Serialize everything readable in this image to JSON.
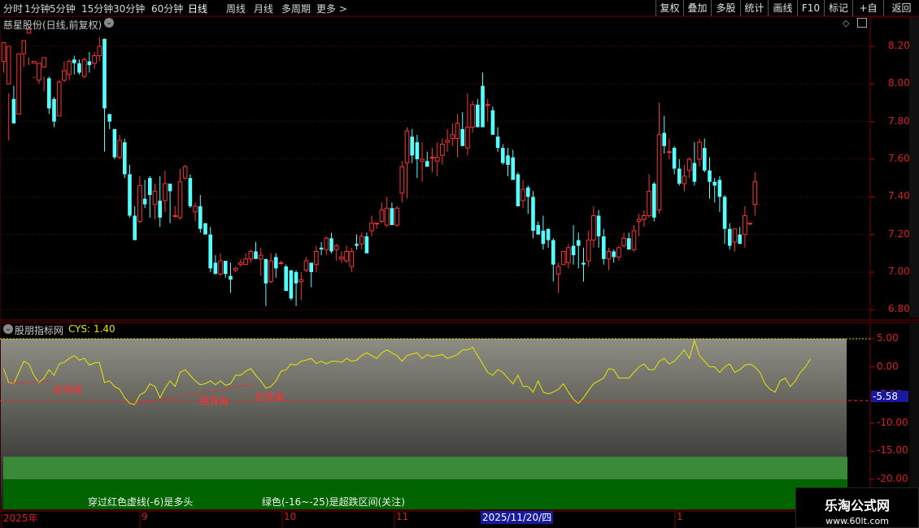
{
  "timeframes": [
    "分时",
    "1分钟",
    "5分钟",
    "15分钟",
    "30分钟",
    "60分钟",
    "日线",
    "周线",
    "月线",
    "多周期",
    "更多 >"
  ],
  "active_timeframe": "日线",
  "toolbar": [
    "复权",
    "叠加",
    "多股",
    "统计",
    "画线",
    "F10",
    "标记",
    "+自选",
    "返回"
  ],
  "main_panel": {
    "title": "慈星股份(日线,前复权)"
  },
  "price_axis": [
    "8.20",
    "8.00",
    "7.80",
    "7.60",
    "7.40",
    "7.20",
    "7.00",
    "6.80"
  ],
  "indicator_panel": {
    "title": "股朋指标网",
    "cys_label": "CYS: 1.40",
    "current_value": "-5.58"
  },
  "indicator_axis": [
    "5.00",
    "0.00",
    "-5.00",
    "-10.00",
    "-15.00",
    "-20.00"
  ],
  "divergence_label": "底背离",
  "notes": [
    "穿过红色虚线(-6)是多头",
    "绿色(-16~-25)是超跌区间(关注)"
  ],
  "date_axis": {
    "labels": [
      "2025年",
      "9",
      "10",
      "11",
      "1"
    ],
    "highlight": "2025/11/20/四"
  },
  "watermark": {
    "name": "乐淘公式网",
    "url": "www.60lt.com"
  },
  "colors": {
    "up": "#ff3232",
    "down": "#54ffff",
    "indicator_line": "#e6e600",
    "red_dash": "#ff2020",
    "oversold_light": "#3a8a3a",
    "oversold_dark": "#006400"
  },
  "chart_data": {
    "type": "candlestick",
    "price_range": [
      6.76,
      8.3
    ],
    "candles": [
      [
        8.12,
        8.22,
        8.14,
        8.06
      ],
      [
        8.0,
        8.2,
        7.95,
        7.7
      ],
      [
        7.92,
        7.79,
        7.99,
        7.79
      ],
      [
        7.84,
        8.16,
        8.16,
        7.84
      ],
      [
        8.16,
        8.23,
        8.22,
        8.09
      ],
      [
        8.27,
        8.29,
        8.14,
        8.1
      ],
      [
        8.11,
        8.12,
        8.04,
        8.03
      ],
      [
        8.02,
        8.11,
        8.08,
        8.0
      ],
      [
        8.09,
        8.14,
        8.04,
        7.96
      ],
      [
        8.03,
        7.87,
        8.04,
        7.84
      ],
      [
        7.92,
        7.8,
        7.93,
        7.77
      ],
      [
        7.83,
        8.01,
        8.02,
        7.83
      ],
      [
        8.02,
        8.07,
        8.12,
        8.01
      ],
      [
        8.05,
        8.12,
        8.13,
        8.02
      ],
      [
        8.13,
        8.11,
        8.15,
        8.05
      ],
      [
        8.11,
        8.06,
        8.13,
        8.05
      ],
      [
        8.04,
        8.13,
        8.14,
        8.03
      ],
      [
        8.12,
        8.1,
        8.17,
        8.06
      ],
      [
        8.11,
        8.15,
        8.17,
        8.08
      ],
      [
        8.15,
        8.2,
        8.25,
        8.12
      ],
      [
        8.24,
        7.87,
        8.24,
        7.64
      ],
      [
        7.84,
        7.8,
        7.84,
        7.76
      ],
      [
        7.76,
        7.61,
        7.76,
        7.6
      ],
      [
        7.61,
        7.7,
        7.73,
        7.6
      ],
      [
        7.69,
        7.52,
        7.71,
        7.5
      ],
      [
        7.52,
        7.3,
        7.57,
        7.29
      ],
      [
        7.3,
        7.17,
        7.35,
        7.17
      ],
      [
        7.27,
        7.46,
        7.51,
        7.26
      ],
      [
        7.39,
        7.36,
        7.49,
        7.34
      ],
      [
        7.5,
        7.41,
        7.51,
        7.29
      ],
      [
        7.36,
        7.43,
        7.47,
        7.28
      ],
      [
        7.38,
        7.29,
        7.51,
        7.24
      ],
      [
        7.38,
        7.47,
        7.54,
        7.32
      ],
      [
        7.47,
        7.43,
        7.47,
        7.26
      ],
      [
        7.3,
        7.3,
        7.35,
        7.29
      ],
      [
        7.29,
        7.48,
        7.55,
        7.28
      ],
      [
        7.5,
        7.56,
        7.57,
        7.49
      ],
      [
        7.5,
        7.35,
        7.52,
        7.34
      ],
      [
        7.32,
        7.35,
        7.37,
        7.27
      ],
      [
        7.35,
        7.23,
        7.41,
        7.21
      ],
      [
        7.26,
        7.2,
        7.26,
        7.2
      ],
      [
        7.2,
        7.02,
        7.24,
        7.0
      ],
      [
        7.05,
        6.99,
        7.09,
        6.99
      ],
      [
        6.99,
        7.06,
        7.1,
        6.98
      ],
      [
        7.06,
        6.99,
        7.06,
        6.97
      ],
      [
        6.98,
        6.96,
        7.05,
        6.89
      ],
      [
        7.01,
        7.02,
        7.03,
        7.0
      ],
      [
        7.04,
        7.05,
        7.07,
        7.03
      ],
      [
        7.04,
        7.07,
        7.1,
        7.04
      ],
      [
        7.07,
        7.11,
        7.12,
        7.05
      ],
      [
        7.11,
        7.07,
        7.16,
        7.07
      ],
      [
        7.07,
        7.09,
        7.13,
        6.98
      ],
      [
        7.07,
        6.94,
        7.07,
        6.82
      ],
      [
        6.95,
        7.06,
        7.1,
        6.94
      ],
      [
        7.08,
        7.02,
        7.1,
        6.97
      ],
      [
        7.05,
        7.05,
        7.06,
        7.04
      ],
      [
        7.03,
        6.9,
        7.04,
        6.9
      ],
      [
        7.01,
        6.86,
        7.0,
        6.85
      ],
      [
        7.0,
        6.94,
        7.01,
        6.82
      ],
      [
        6.95,
        6.96,
        7.0,
        6.85
      ],
      [
        7.01,
        7.06,
        7.08,
        7.0
      ],
      [
        7.05,
        7.0,
        7.05,
        6.92
      ],
      [
        7.04,
        7.11,
        7.14,
        7.0
      ],
      [
        7.13,
        7.12,
        7.16,
        7.09
      ],
      [
        7.12,
        7.18,
        7.19,
        7.09
      ],
      [
        7.18,
        7.11,
        7.21,
        7.1
      ],
      [
        7.12,
        7.14,
        7.15,
        7.06
      ],
      [
        7.07,
        7.08,
        7.11,
        7.05
      ],
      [
        7.06,
        7.11,
        7.14,
        7.05
      ],
      [
        7.03,
        7.11,
        7.13,
        7.0
      ],
      [
        7.15,
        7.14,
        7.2,
        7.12
      ],
      [
        7.15,
        7.19,
        7.21,
        7.12
      ],
      [
        7.19,
        7.1,
        7.21,
        7.1
      ],
      [
        7.22,
        7.26,
        7.3,
        7.19
      ],
      [
        7.26,
        7.26,
        7.26,
        7.23
      ],
      [
        7.27,
        7.33,
        7.37,
        7.26
      ],
      [
        7.25,
        7.34,
        7.4,
        7.24
      ],
      [
        7.34,
        7.25,
        7.37,
        7.26
      ],
      [
        7.25,
        7.34,
        7.35,
        7.24
      ],
      [
        7.42,
        7.56,
        7.59,
        7.37
      ],
      [
        7.58,
        7.75,
        7.77,
        7.39
      ],
      [
        7.72,
        7.62,
        7.76,
        7.58
      ],
      [
        7.69,
        7.6,
        7.73,
        7.5
      ],
      [
        7.59,
        7.6,
        7.69,
        7.48
      ],
      [
        7.59,
        7.56,
        7.64,
        7.56
      ],
      [
        7.61,
        7.61,
        7.66,
        7.53
      ],
      [
        7.59,
        7.61,
        7.69,
        7.51
      ],
      [
        7.62,
        7.68,
        7.71,
        7.57
      ],
      [
        7.69,
        7.7,
        7.76,
        7.64
      ],
      [
        7.71,
        7.73,
        7.79,
        7.67
      ],
      [
        7.71,
        7.79,
        7.84,
        7.61
      ],
      [
        7.76,
        7.67,
        7.85,
        7.67
      ],
      [
        7.66,
        7.77,
        7.95,
        7.62
      ],
      [
        7.77,
        7.89,
        7.91,
        7.74
      ],
      [
        7.89,
        7.77,
        7.92,
        7.77
      ],
      [
        7.99,
        7.77,
        8.06,
        7.79
      ],
      [
        7.89,
        7.89,
        7.92,
        7.8
      ],
      [
        7.86,
        7.73,
        7.88,
        7.73
      ],
      [
        7.72,
        7.66,
        7.77,
        7.64
      ],
      [
        7.66,
        7.58,
        7.68,
        7.57
      ],
      [
        7.62,
        7.57,
        7.66,
        7.51
      ],
      [
        7.61,
        7.49,
        7.65,
        7.5
      ],
      [
        7.52,
        7.35,
        7.53,
        7.35
      ],
      [
        7.38,
        7.44,
        7.49,
        7.34
      ],
      [
        7.45,
        7.4,
        7.46,
        7.31
      ],
      [
        7.4,
        7.22,
        7.43,
        7.18
      ],
      [
        7.25,
        7.2,
        7.27,
        7.2
      ],
      [
        7.22,
        7.15,
        7.3,
        7.12
      ],
      [
        7.23,
        7.17,
        7.23,
        7.13
      ],
      [
        7.17,
        7.04,
        7.18,
        6.95
      ],
      [
        6.99,
        7.03,
        7.05,
        6.89
      ],
      [
        7.04,
        7.11,
        7.11,
        7.04
      ],
      [
        7.05,
        7.13,
        7.15,
        7.02
      ],
      [
        7.14,
        7.09,
        7.25,
        7.04
      ],
      [
        7.17,
        7.14,
        7.21,
        7.02
      ],
      [
        7.05,
        7.04,
        7.13,
        6.95
      ],
      [
        7.06,
        7.17,
        7.22,
        7.03
      ],
      [
        7.17,
        7.3,
        7.35,
        7.13
      ],
      [
        7.3,
        7.19,
        7.33,
        7.13
      ],
      [
        7.19,
        7.07,
        7.23,
        7.04
      ],
      [
        7.07,
        7.11,
        7.13,
        7.01
      ],
      [
        7.11,
        7.08,
        7.12,
        7.05
      ],
      [
        7.08,
        7.13,
        7.14,
        7.06
      ],
      [
        7.14,
        7.18,
        7.21,
        7.13
      ],
      [
        7.18,
        7.12,
        7.21,
        7.12
      ],
      [
        7.12,
        7.22,
        7.25,
        7.11
      ],
      [
        7.27,
        7.28,
        7.31,
        7.19
      ],
      [
        7.28,
        7.3,
        7.33,
        7.24
      ],
      [
        7.3,
        7.43,
        7.52,
        7.29
      ],
      [
        7.47,
        7.29,
        7.48,
        7.27
      ],
      [
        7.33,
        7.73,
        7.9,
        7.31
      ],
      [
        7.74,
        7.67,
        7.83,
        7.63
      ],
      [
        7.64,
        7.64,
        7.71,
        7.6
      ],
      [
        7.66,
        7.55,
        7.67,
        7.52
      ],
      [
        7.55,
        7.47,
        7.6,
        7.46
      ],
      [
        7.47,
        7.51,
        7.57,
        7.43
      ],
      [
        7.54,
        7.6,
        7.61,
        7.5
      ],
      [
        7.58,
        7.48,
        7.69,
        7.46
      ],
      [
        7.6,
        7.69,
        7.71,
        7.56
      ],
      [
        7.66,
        7.54,
        7.71,
        7.53
      ],
      [
        7.54,
        7.48,
        7.61,
        7.39
      ],
      [
        7.48,
        7.46,
        7.5,
        7.37
      ],
      [
        7.49,
        7.4,
        7.51,
        7.32
      ],
      [
        7.4,
        7.23,
        7.41,
        7.15
      ],
      [
        7.23,
        7.14,
        7.26,
        7.12
      ],
      [
        7.16,
        7.23,
        7.23,
        7.11
      ],
      [
        7.2,
        7.15,
        7.24,
        7.16
      ],
      [
        7.2,
        7.3,
        7.35,
        7.13
      ],
      [
        7.26,
        7.26,
        7.26,
        7.25
      ],
      [
        7.36,
        7.48,
        7.53,
        7.3
      ]
    ],
    "cys_range": [
      -20.0,
      7.5
    ],
    "cys": [
      -0.3,
      -2.8,
      -3.0,
      -1.0,
      1.0,
      0.5,
      -1.5,
      -2.8,
      -2.0,
      -0.5,
      -1.5,
      0.5,
      0.8,
      1.5,
      2.0,
      1.2,
      1.5,
      0.3,
      0.7,
      0.8,
      -2.8,
      -2.5,
      -3.5,
      -4.0,
      -5.5,
      -6.5,
      -6.7,
      -5.0,
      -4.5,
      -3.0,
      -3.5,
      -5.5,
      -3.8,
      -2.5,
      -3.5,
      -1.0,
      -0.5,
      -1.5,
      -2.5,
      -3.2,
      -3.0,
      -2.5,
      -3.2,
      -2.5,
      -3.3,
      -3.0,
      -1.5,
      -1.5,
      -0.8,
      -0.3,
      -1.5,
      -2.5,
      -3.8,
      -3.5,
      -2.5,
      -0.8,
      -0.5,
      0.5,
      0.3,
      1.0,
      1.2,
      1.5,
      0.6,
      1.0,
      0.5,
      1.0,
      1.0,
      0.8,
      1.5,
      1.0,
      1.2,
      2.0,
      2.5,
      2.0,
      1.5,
      2.5,
      3.0,
      2.5,
      2.0,
      1.0,
      2.0,
      2.3,
      2.5,
      1.5,
      2.2,
      1.8,
      2.0,
      2.2,
      1.5,
      1.8,
      2.2,
      3.0,
      3.0,
      3.5,
      2.0,
      0.5,
      -1.0,
      -1.5,
      -0.5,
      -1.0,
      -2.0,
      -3.0,
      -1.5,
      -3.5,
      -3.5,
      -4.5,
      -2.5,
      -4.5,
      -4.8,
      -4.5,
      -4.0,
      -3.0,
      -4.5,
      -5.8,
      -6.5,
      -5.5,
      -4.2,
      -3.0,
      -2.5,
      -2.0,
      -0.3,
      -0.5,
      -2.0,
      -2.0,
      -2.0,
      -1.0,
      0.0,
      0.5,
      -0.5,
      -0.5,
      1.0,
      1.5,
      0.5,
      1.0,
      2.0,
      3.0,
      1.5,
      4.7,
      2.0,
      1.0,
      0.0,
      0.0,
      -1.0,
      0.0,
      0.5,
      -1.0,
      -0.5,
      0.3,
      0.5,
      0.0,
      -1.0,
      -3.0,
      -4.0,
      -4.5,
      -2.5,
      -2.0,
      -3.5,
      -2.5,
      -1.0,
      0.0,
      1.4
    ],
    "cys_threshold": -6,
    "oversold_band": [
      -16,
      -25
    ],
    "divergence_lines": [
      {
        "from": [
          1,
          -3.0
        ],
        "to": [
          10,
          -2.5
        ]
      },
      {
        "from": [
          26,
          -6.6
        ],
        "to": [
          50,
          -3.0
        ]
      }
    ],
    "divergence_labels": [
      {
        "index": 10,
        "value": -2.5
      },
      {
        "index": 39,
        "value": -4.5
      },
      {
        "index": 50,
        "value": -3.8
      }
    ]
  }
}
